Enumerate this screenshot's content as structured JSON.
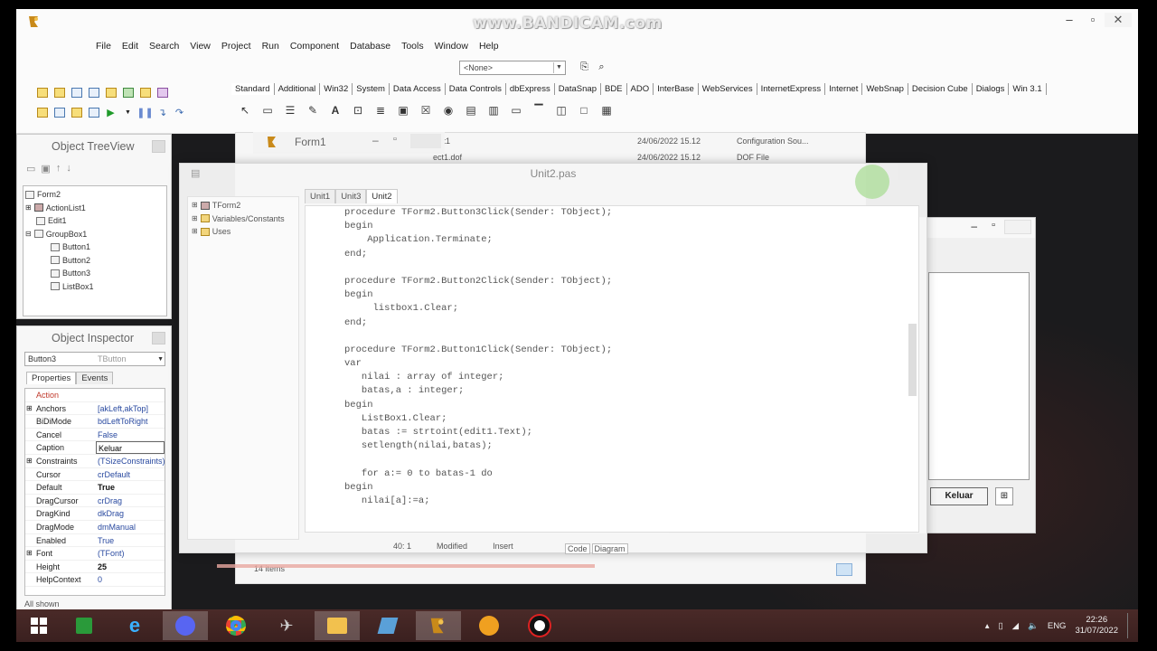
{
  "watermark": "www.BANDICAM.com",
  "menu": [
    "File",
    "Edit",
    "Search",
    "View",
    "Project",
    "Run",
    "Component",
    "Database",
    "Tools",
    "Window",
    "Help"
  ],
  "toolbar": {
    "combo_value": "<None>"
  },
  "palette_tabs": [
    "Standard",
    "Additional",
    "Win32",
    "System",
    "Data Access",
    "Data Controls",
    "dbExpress",
    "DataSnap",
    "BDE",
    "ADO",
    "InterBase",
    "WebServices",
    "InternetExpress",
    "Internet",
    "WebSnap",
    "Decision Cube",
    "Dialogs",
    "Win 3.1"
  ],
  "tree_panel": {
    "title": "Object TreeView",
    "nodes": [
      "Form2",
      "ActionList1",
      "Edit1",
      "GroupBox1",
      "Button1",
      "Button2",
      "Button3",
      "ListBox1"
    ]
  },
  "inspector": {
    "title": "Object Inspector",
    "selected_object": "Button3",
    "selected_type": "TButton",
    "tabs": [
      "Properties",
      "Events"
    ],
    "properties": [
      {
        "name": "Action",
        "value": ""
      },
      {
        "name": "Anchors",
        "value": "[akLeft,akTop]"
      },
      {
        "name": "BiDiMode",
        "value": "bdLeftToRight"
      },
      {
        "name": "Cancel",
        "value": "False"
      },
      {
        "name": "Caption",
        "value": "Keluar"
      },
      {
        "name": "Constraints",
        "value": "(TSizeConstraints)"
      },
      {
        "name": "Cursor",
        "value": "crDefault"
      },
      {
        "name": "Default",
        "value": "True"
      },
      {
        "name": "DragCursor",
        "value": "crDrag"
      },
      {
        "name": "DragKind",
        "value": "dkDrag"
      },
      {
        "name": "DragMode",
        "value": "dmManual"
      },
      {
        "name": "Enabled",
        "value": "True"
      },
      {
        "name": "Font",
        "value": "(TFont)"
      },
      {
        "name": "Height",
        "value": "25"
      },
      {
        "name": "HelpContext",
        "value": "0"
      }
    ],
    "status": "All shown"
  },
  "explorer": {
    "rows": [
      {
        "name": "ject1",
        "date": "24/06/2022 15.12",
        "type": "Configuration Sou..."
      },
      {
        "name": "ect1.dof",
        "date": "24/06/2022 15.12",
        "type": "DOF File"
      }
    ],
    "status": "14 items"
  },
  "form1_title": "Form1",
  "editor": {
    "title": "Unit2.pas",
    "tree": [
      "TForm2",
      "Variables/Constants",
      "Uses"
    ],
    "tabs": [
      "Unit1",
      "Unit3",
      "Unit2"
    ],
    "code": [
      "procedure TForm2.Button3Click(Sender: TObject);",
      "begin",
      "    Application.Terminate;",
      "end;",
      "",
      "procedure TForm2.Button2Click(Sender: TObject);",
      "begin",
      "     listbox1.Clear;",
      "end;",
      "",
      "procedure TForm2.Button1Click(Sender: TObject);",
      "var",
      "   nilai : array of integer;",
      "   batas,a : integer;",
      "begin",
      "   ListBox1.Clear;",
      "   batas := strtoint(edit1.Text);",
      "   setlength(nilai,batas);",
      "",
      "   for a:= 0 to batas-1 do",
      "begin",
      "   nilai[a]:=a;"
    ],
    "status_pos": "40: 1",
    "status_state": "Modified",
    "status_mode": "Insert",
    "bottom_tabs": [
      "Code",
      "Diagram"
    ]
  },
  "form2": {
    "keluar_label": "Keluar"
  },
  "tray": {
    "lang": "ENG",
    "time": "22:26",
    "date": "31/07/2022"
  },
  "colors": {
    "accent": "#2a4aa0",
    "taskbar": "#3a201f"
  }
}
